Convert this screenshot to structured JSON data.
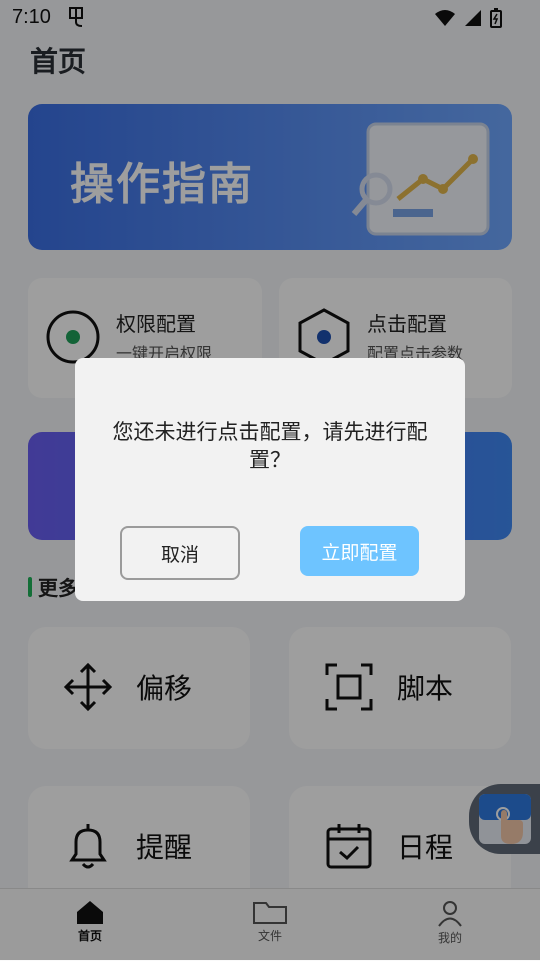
{
  "status_bar": {
    "time": "7:10"
  },
  "page_title": "首页",
  "banner": {
    "title": "操作指南"
  },
  "cards": [
    {
      "title": "权限配置",
      "subtitle": "一键开启权限"
    },
    {
      "title": "点击配置",
      "subtitle": "配置点击参数"
    }
  ],
  "section_label": "更多",
  "tools": [
    {
      "label": "偏移",
      "icon": "move-arrows-icon"
    },
    {
      "label": "脚本",
      "icon": "focus-frame-icon"
    },
    {
      "label": "提醒",
      "icon": "bell-icon"
    },
    {
      "label": "日程",
      "icon": "calendar-icon"
    }
  ],
  "nav": [
    {
      "label": "首页",
      "icon": "home-icon",
      "active": true
    },
    {
      "label": "文件",
      "icon": "folder-icon"
    },
    {
      "label": "我的",
      "icon": "person-icon"
    }
  ],
  "dialog": {
    "message": "您还未进行点击配置，请先进行配置？",
    "cancel_label": "取消",
    "confirm_label": "立即配置"
  },
  "colors": {
    "accent": "#6ec4ff",
    "green_bar": "#1fb25a",
    "banner_start": "#3b6fe4",
    "banner_end": "#6fa7ff"
  }
}
